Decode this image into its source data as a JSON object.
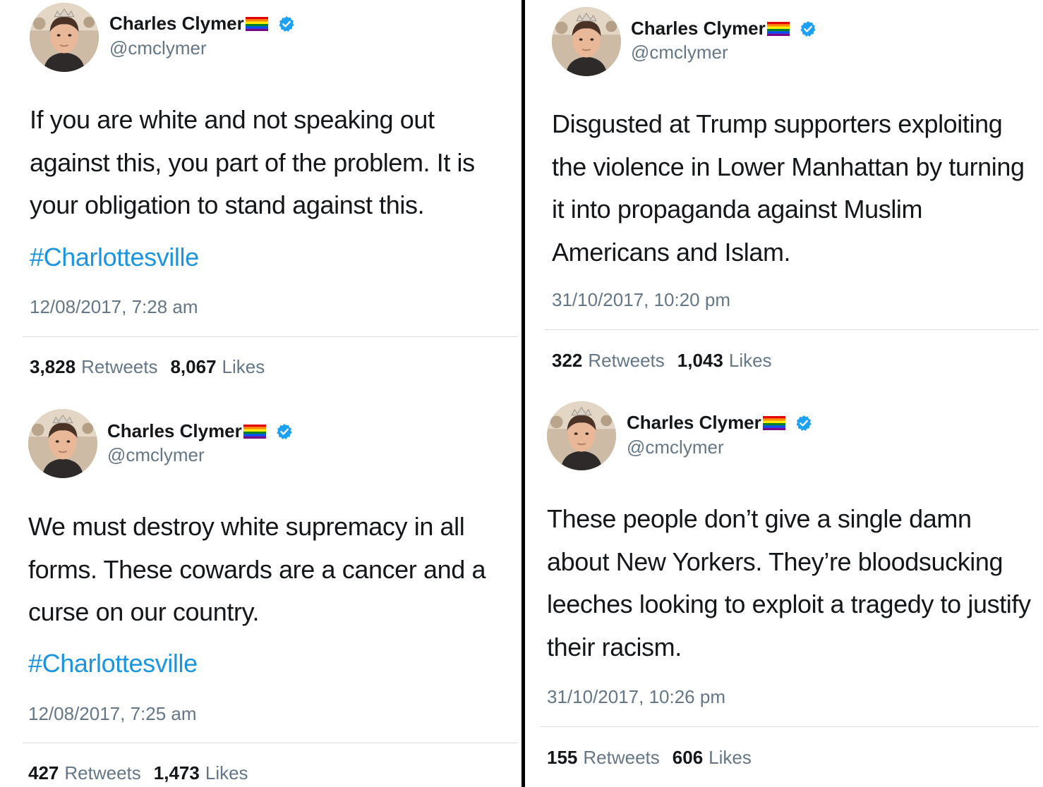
{
  "tweets": [
    {
      "name": "Charles Clymer",
      "handle": "@cmclymer",
      "text": "If you are white and not speaking out against this, you part of the problem. It is your obligation to stand against this.",
      "hashtag": "#Charlottesville",
      "timestamp": "12/08/2017, 7:28 am",
      "retweets": "3,828",
      "retweets_label": "Retweets",
      "likes": "8,067",
      "likes_label": "Likes"
    },
    {
      "name": "Charles Clymer",
      "handle": "@cmclymer",
      "text": "We must destroy white supremacy in all forms. These cowards are a cancer and a curse on our country.",
      "hashtag": "#Charlottesville",
      "timestamp": "12/08/2017, 7:25 am",
      "retweets": "427",
      "retweets_label": "Retweets",
      "likes": "1,473",
      "likes_label": "Likes"
    },
    {
      "name": "Charles Clymer",
      "handle": "@cmclymer",
      "text": "Disgusted at Trump supporters exploiting the violence in Lower Manhattan by turning it into propaganda against Muslim Americans and Islam.",
      "timestamp": "31/10/2017, 10:20 pm",
      "retweets": "322",
      "retweets_label": "Retweets",
      "likes": "1,043",
      "likes_label": "Likes"
    },
    {
      "name": "Charles Clymer",
      "handle": "@cmclymer",
      "text": "These people don’t give a single damn about New Yorkers. They’re bloodsucking leeches looking to exploit a tragedy to justify their racism.",
      "timestamp": "31/10/2017, 10:26 pm",
      "retweets": "155",
      "retweets_label": "Retweets",
      "likes": "606",
      "likes_label": "Likes"
    }
  ],
  "colors": {
    "hashtag": "#1b95e0",
    "verified": "#1da1f2",
    "muted": "#657786"
  },
  "icons": {
    "verified": "verified-badge-icon",
    "flag": "rainbow-flag-icon"
  }
}
